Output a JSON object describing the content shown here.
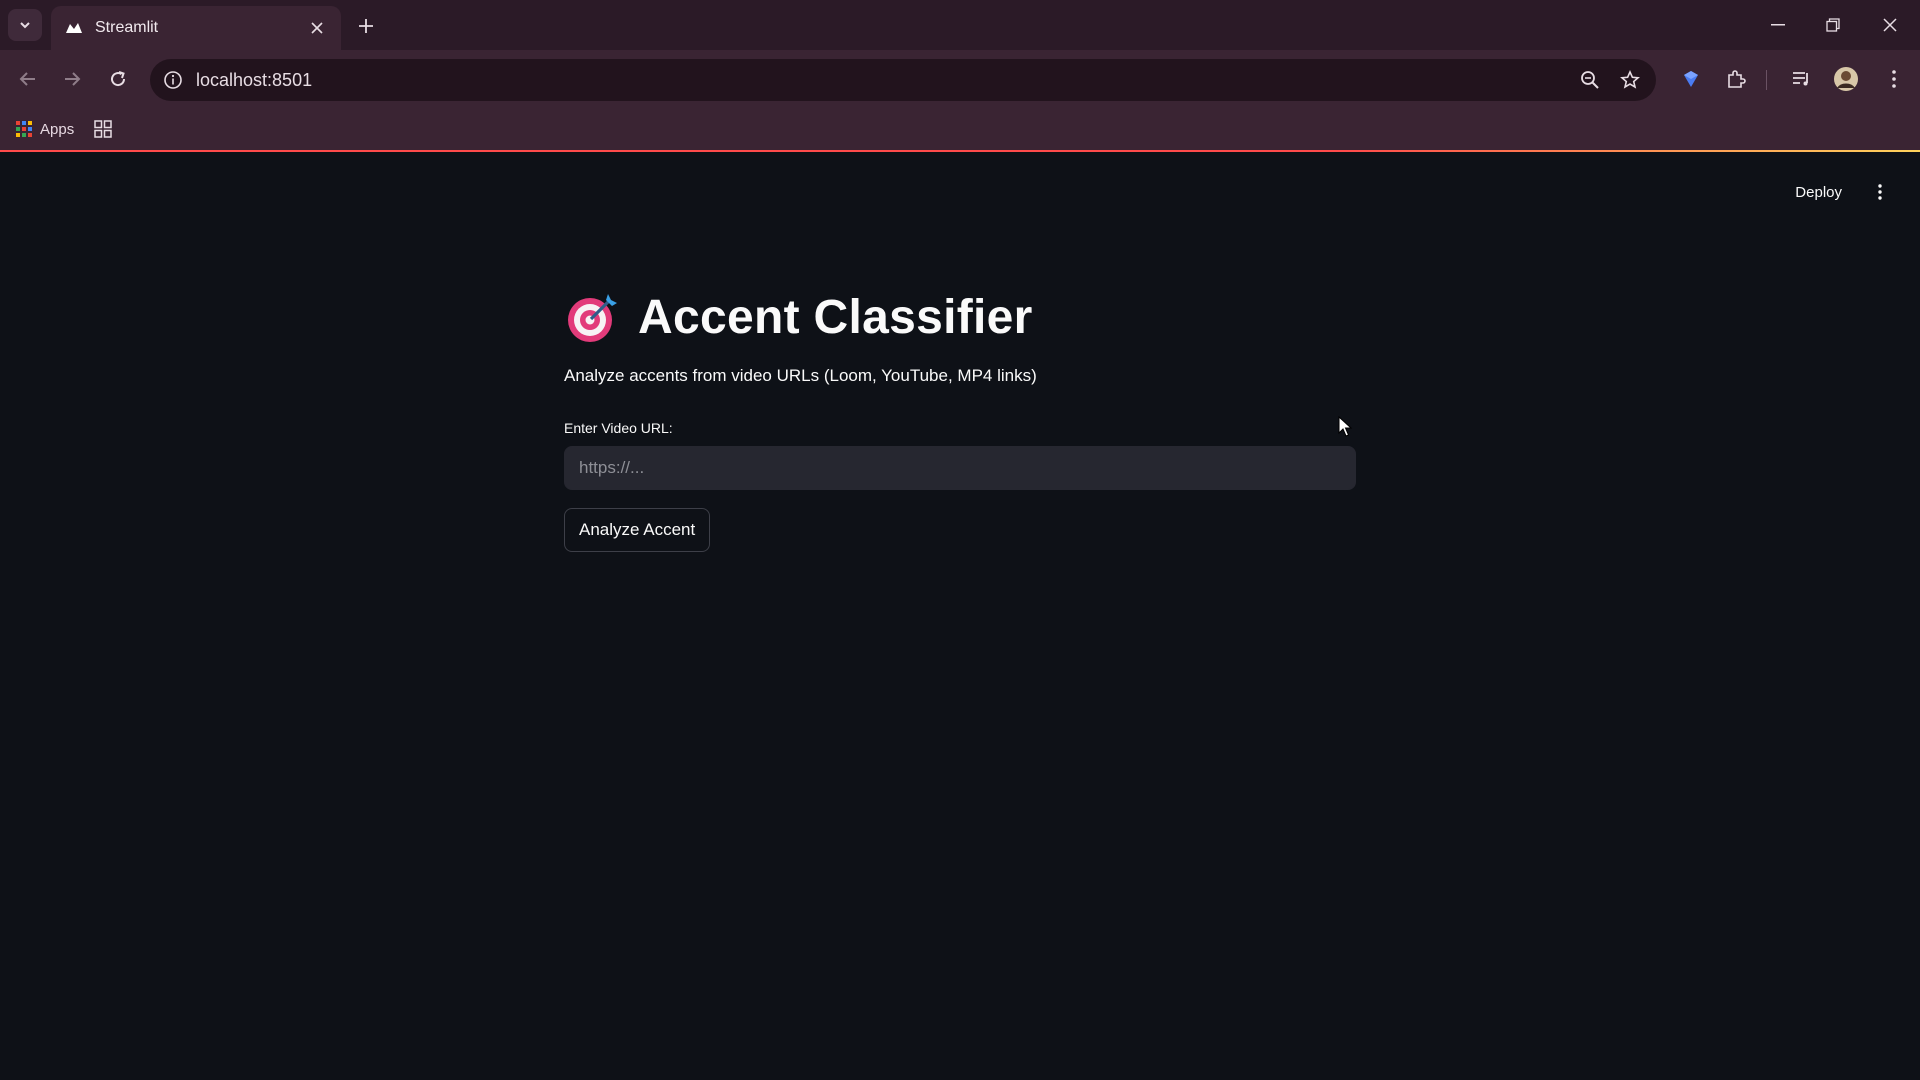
{
  "browser": {
    "tab": {
      "title": "Streamlit"
    },
    "address_bar": {
      "url": "localhost:8501"
    },
    "bookmarks": {
      "apps_label": "Apps"
    }
  },
  "app": {
    "header": {
      "deploy_label": "Deploy"
    },
    "title": "Accent Classifier",
    "subtitle": "Analyze accents from video URLs (Loom, YouTube, MP4 links)",
    "url_field": {
      "label": "Enter Video URL:",
      "value": "",
      "placeholder": "https://..."
    },
    "analyze_button": {
      "label": "Analyze Accent"
    }
  },
  "colors": {
    "app_background": "#0e1117",
    "input_background": "#262730",
    "browser_frame": "#3a2433",
    "accent_red": "#ff4b4b"
  },
  "icons": [
    "tab-list-icon",
    "streamlit-logo-icon",
    "close-icon",
    "plus-icon",
    "minimize-icon",
    "restore-icon",
    "back-icon",
    "forward-icon",
    "reload-icon",
    "site-info-icon",
    "zoom-icon",
    "star-icon",
    "extension-shield-icon",
    "puzzle-icon",
    "media-control-icon",
    "avatar",
    "kebab-menu-icon",
    "apps-grid-icon",
    "tab-groups-icon",
    "direct-hit-icon",
    "cursor-icon"
  ]
}
